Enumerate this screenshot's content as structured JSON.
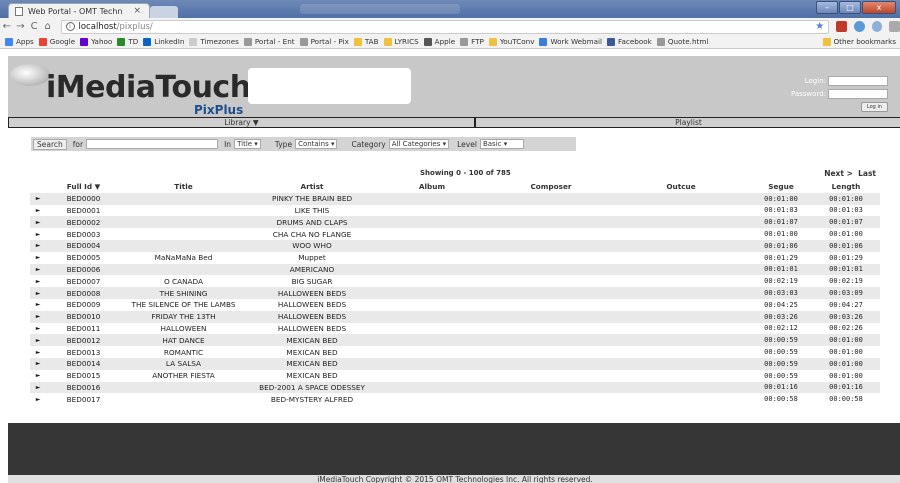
{
  "browser": {
    "tab_title": "Web Portal - OMT Techn",
    "tab_close": "×",
    "url_host": "localhost",
    "url_path": "/pixplus/",
    "window_close": "x",
    "bookmarks": [
      {
        "label": "Apps",
        "icon": "apps-icon",
        "color": "#4285f4"
      },
      {
        "label": "Google",
        "icon": "google-icon",
        "color": "#ea4335"
      },
      {
        "label": "Yahoo",
        "icon": "yahoo-icon",
        "color": "#6001d2"
      },
      {
        "label": "TD",
        "icon": "td-icon",
        "color": "#2c8a2c"
      },
      {
        "label": "LinkedIn",
        "icon": "linkedin-icon",
        "color": "#0a66c2"
      },
      {
        "label": "Timezones",
        "icon": "separator-icon",
        "color": "#cccccc"
      },
      {
        "label": "Portal - Ent",
        "icon": "page-icon",
        "color": "#999999"
      },
      {
        "label": "Portal - Pix",
        "icon": "page-icon",
        "color": "#999999"
      },
      {
        "label": "TAB",
        "icon": "folder-icon",
        "color": "#f0c040"
      },
      {
        "label": "LYRICS",
        "icon": "folder-icon",
        "color": "#f0c040"
      },
      {
        "label": "Apple",
        "icon": "apple-icon",
        "color": "#555555"
      },
      {
        "label": "FTP",
        "icon": "page-icon",
        "color": "#999999"
      },
      {
        "label": "YouTConv",
        "icon": "folder-icon",
        "color": "#f0c040"
      },
      {
        "label": "Work Webmail",
        "icon": "mail-icon",
        "color": "#3b7dd8"
      },
      {
        "label": "Facebook",
        "icon": "facebook-icon",
        "color": "#3b5998"
      },
      {
        "label": "Quote.html",
        "icon": "page-icon",
        "color": "#999999"
      }
    ],
    "other_bookmarks": "Other bookmarks"
  },
  "header": {
    "logo_main": "iMediaTouch",
    "logo_sub": "PixPlus",
    "login_label": "Login:",
    "password_label": "Password:",
    "login_button": "Log in"
  },
  "nav": {
    "library": "Library ▼",
    "playlist": "Playlist"
  },
  "search": {
    "search_button": "Search",
    "for_label": "for",
    "in_label": "In",
    "in_value": "Title",
    "type_label": "Type",
    "type_value": "Contains",
    "category_label": "Category",
    "category_value": "All Categories",
    "level_label": "Level",
    "level_value": "Basic"
  },
  "showing": "Showing 0 - 100 of 785",
  "pager": {
    "next": "Next >",
    "last": "Last"
  },
  "table": {
    "headers": [
      "Full Id ▼",
      "Title",
      "Artist",
      "Album",
      "Composer",
      "Outcue",
      "Segue",
      "Length"
    ],
    "rows": [
      {
        "id": "BED0000",
        "title": "",
        "artist": "PINKY THE BRAIN BED",
        "segue": "00:01:00",
        "length": "00:01:00"
      },
      {
        "id": "BED0001",
        "title": "",
        "artist": "LIKE THIS",
        "segue": "00:01:03",
        "length": "00:01:03"
      },
      {
        "id": "BED0002",
        "title": "",
        "artist": "DRUMS AND CLAPS",
        "segue": "00:01:07",
        "length": "00:01:07"
      },
      {
        "id": "BED0003",
        "title": "",
        "artist": "CHA CHA NO FLANGE",
        "segue": "00:01:00",
        "length": "00:01:00"
      },
      {
        "id": "BED0004",
        "title": "",
        "artist": "WOO WHO",
        "segue": "00:01:06",
        "length": "00:01:06"
      },
      {
        "id": "BED0005",
        "title": "MaNaMaNa Bed",
        "artist": "Muppet",
        "segue": "00:01:29",
        "length": "00:01:29"
      },
      {
        "id": "BED0006",
        "title": "",
        "artist": "AMERICANO",
        "segue": "00:01:01",
        "length": "00:01:01"
      },
      {
        "id": "BED0007",
        "title": "O CANADA",
        "artist": "BIG SUGAR",
        "segue": "00:02:19",
        "length": "00:02:19"
      },
      {
        "id": "BED0008",
        "title": "THE SHINING",
        "artist": "HALLOWEEN BEDS",
        "segue": "00:03:03",
        "length": "00:03:09"
      },
      {
        "id": "BED0009",
        "title": "THE SILENCE OF THE LAMBS",
        "artist": "HALLOWEEN BEDS",
        "segue": "00:04:25",
        "length": "00:04:27"
      },
      {
        "id": "BED0010",
        "title": "FRIDAY THE 13TH",
        "artist": "HALLOWEEN BEDS",
        "segue": "00:03:26",
        "length": "00:03:26"
      },
      {
        "id": "BED0011",
        "title": "HALLOWEEN",
        "artist": "HALLOWEEN BEDS",
        "segue": "00:02:12",
        "length": "00:02:26"
      },
      {
        "id": "BED0012",
        "title": "HAT DANCE",
        "artist": "MEXICAN BED",
        "segue": "00:00:59",
        "length": "00:01:00"
      },
      {
        "id": "BED0013",
        "title": "ROMANTIC",
        "artist": "MEXICAN BED",
        "segue": "00:00:59",
        "length": "00:01:00"
      },
      {
        "id": "BED0014",
        "title": "LA SALSA",
        "artist": "MEXICAN BED",
        "segue": "00:00:59",
        "length": "00:01:00"
      },
      {
        "id": "BED0015",
        "title": "ANOTHER FIESTA",
        "artist": "MEXICAN BED",
        "segue": "00:00:59",
        "length": "00:01:00"
      },
      {
        "id": "BED0016",
        "title": "",
        "artist": "BED-2001 A SPACE ODESSEY",
        "segue": "00:01:16",
        "length": "00:01:16"
      },
      {
        "id": "BED0017",
        "title": "",
        "artist": "BED-MYSTERY ALFRED",
        "segue": "00:00:58",
        "length": "00:00:58"
      }
    ]
  },
  "footer": "iMediaTouch Copyright © 2015 OMT Technologies Inc. All rights reserved."
}
